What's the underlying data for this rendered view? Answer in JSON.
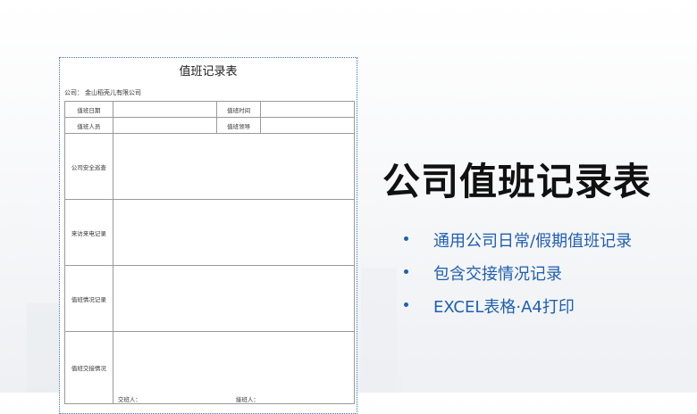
{
  "document": {
    "title": "值班记录表",
    "company_label": "公司：",
    "company_name": "金山稻壳儿有限公司",
    "rows": {
      "date_label": "值班日期",
      "time_label": "值班时间",
      "staff_label": "值班人员",
      "leader_label": "值班领导",
      "security_label": "公司安全巡查",
      "visits_label": "来访来电记录",
      "status_label": "值班情况记录",
      "handover_label": "值班交接情况",
      "handover_by": "交班人：",
      "received_by": "接班人："
    }
  },
  "headline": "公司值班记录表",
  "features": [
    "通用公司日常/假期值班记录",
    "包含交接情况记录",
    "EXCEL表格·A4打印"
  ],
  "colors": {
    "accent": "#1f5fb0",
    "doc_border": "#3b6fc4"
  }
}
